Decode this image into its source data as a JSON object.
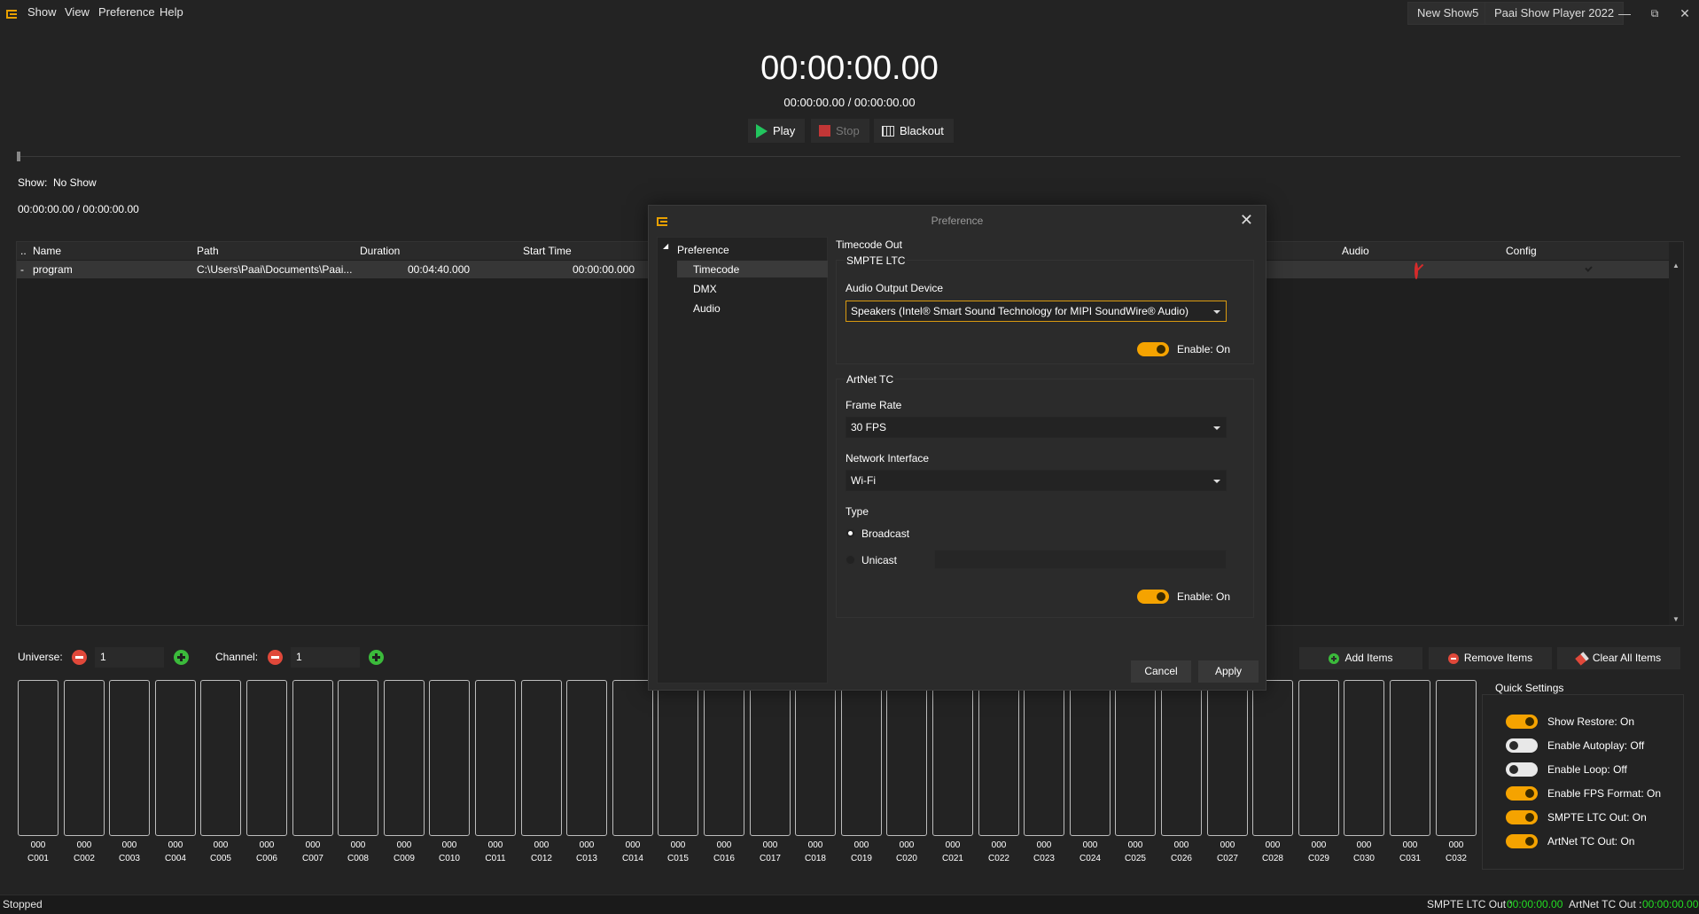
{
  "menu": {
    "items": [
      "Show",
      "View",
      "Preference",
      "Help"
    ]
  },
  "titlebar": {
    "show_name": "New Show5",
    "app_name": "Paai Show Player 2022"
  },
  "transport": {
    "big_time": "00:00:00.00",
    "small_time": "00:00:00.00 / 00:00:00.00",
    "play_label": "Play",
    "stop_label": "Stop",
    "blackout_label": "Blackout",
    "progress": 0
  },
  "show_info": {
    "show_label": "Show:",
    "show_value": "No Show",
    "time": "00:00:00.00 / 00:00:00.00"
  },
  "table": {
    "columns": [
      "Name",
      "Path",
      "Duration",
      "Start Time",
      "Audio",
      "Config"
    ],
    "rows": [
      {
        "name": "program",
        "path": "C:\\Users\\Paai\\Documents\\Paai...",
        "duration": "00:04:40.000",
        "start_time": "00:00:00.000",
        "audio_icon": "prohibited-icon",
        "config_icon": "check-circle-icon"
      }
    ]
  },
  "controls": {
    "universe_label": "Universe:",
    "universe_value": "1",
    "channel_label": "Channel:",
    "channel_value": "1",
    "add_items": "Add Items",
    "remove_items": "Remove Items",
    "clear_all_items": "Clear All Items"
  },
  "channels": [
    {
      "value": "000",
      "label": "C001"
    },
    {
      "value": "000",
      "label": "C002"
    },
    {
      "value": "000",
      "label": "C003"
    },
    {
      "value": "000",
      "label": "C004"
    },
    {
      "value": "000",
      "label": "C005"
    },
    {
      "value": "000",
      "label": "C006"
    },
    {
      "value": "000",
      "label": "C007"
    },
    {
      "value": "000",
      "label": "C008"
    },
    {
      "value": "000",
      "label": "C009"
    },
    {
      "value": "000",
      "label": "C010"
    },
    {
      "value": "000",
      "label": "C011"
    },
    {
      "value": "000",
      "label": "C012"
    },
    {
      "value": "000",
      "label": "C013"
    },
    {
      "value": "000",
      "label": "C014"
    },
    {
      "value": "000",
      "label": "C015"
    },
    {
      "value": "000",
      "label": "C016"
    },
    {
      "value": "000",
      "label": "C017"
    },
    {
      "value": "000",
      "label": "C018"
    },
    {
      "value": "000",
      "label": "C019"
    },
    {
      "value": "000",
      "label": "C020"
    },
    {
      "value": "000",
      "label": "C021"
    },
    {
      "value": "000",
      "label": "C022"
    },
    {
      "value": "000",
      "label": "C023"
    },
    {
      "value": "000",
      "label": "C024"
    },
    {
      "value": "000",
      "label": "C025"
    },
    {
      "value": "000",
      "label": "C026"
    },
    {
      "value": "000",
      "label": "C027"
    },
    {
      "value": "000",
      "label": "C028"
    },
    {
      "value": "000",
      "label": "C029"
    },
    {
      "value": "000",
      "label": "C030"
    },
    {
      "value": "000",
      "label": "C031"
    },
    {
      "value": "000",
      "label": "C032"
    }
  ],
  "quick_settings": {
    "title": "Quick Settings",
    "items": [
      {
        "label": "Show Restore: On",
        "on": true
      },
      {
        "label": "Enable Autoplay: Off",
        "on": false
      },
      {
        "label": "Enable Loop: Off",
        "on": false
      },
      {
        "label": "Enable FPS Format: On",
        "on": true
      },
      {
        "label": "SMPTE LTC Out: On",
        "on": true
      },
      {
        "label": "ArtNet TC Out: On",
        "on": true
      }
    ]
  },
  "status": {
    "state": "Stopped",
    "smpte_label": "SMPTE LTC Out :",
    "smpte_value": "00:00:00.00",
    "artnet_label": "ArtNet TC Out :",
    "artnet_value": "00:00:00.00"
  },
  "dialog": {
    "title": "Preference",
    "tree": {
      "root": "Preference",
      "children": [
        "Timecode",
        "DMX",
        "Audio"
      ],
      "selected": "Timecode"
    },
    "section_title": "Timecode Out",
    "smpte": {
      "group_title": "SMPTE LTC",
      "device_label": "Audio Output Device",
      "device_value": "Speakers (Intel® Smart Sound Technology for MIPI SoundWire® Audio)",
      "enable_label": "Enable: On"
    },
    "artnet": {
      "group_title": "ArtNet TC",
      "frame_rate_label": "Frame Rate",
      "frame_rate_value": "30 FPS",
      "network_label": "Network Interface",
      "network_value": "Wi-Fi",
      "type_label": "Type",
      "broadcast_label": "Broadcast",
      "unicast_label": "Unicast",
      "unicast_address": "",
      "enable_label": "Enable: On"
    },
    "cancel_label": "Cancel",
    "apply_label": "Apply"
  },
  "colors": {
    "accent": "#f5a300",
    "play": "#22c55e",
    "stop": "#c23636",
    "timecode_green": "#22dd22"
  }
}
